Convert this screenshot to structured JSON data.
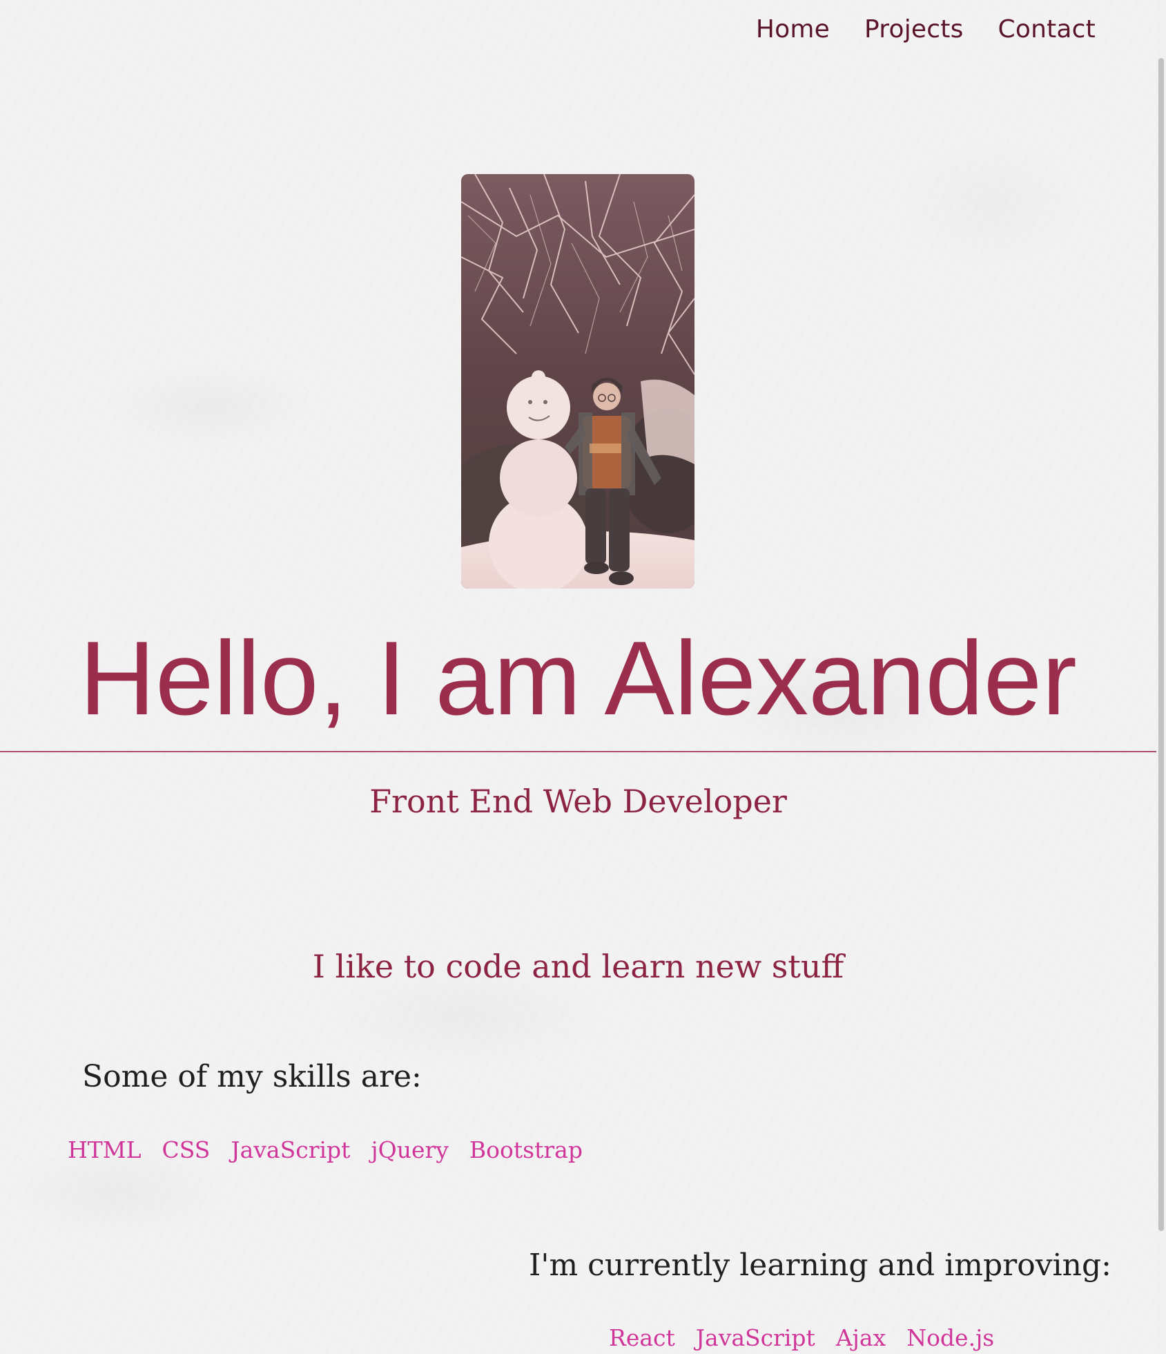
{
  "nav": {
    "items": [
      "Home",
      "Projects",
      "Contact"
    ]
  },
  "hero": {
    "title": "Hello, I am Alexander",
    "subtitle": "Front End Web Developer",
    "tagline": "I like to code and learn new stuff"
  },
  "skills": {
    "heading": "Some of my skills are:",
    "items": [
      "HTML",
      "CSS",
      "JavaScript",
      "jQuery",
      "Bootstrap"
    ]
  },
  "learning": {
    "heading": "I'm currently learning and improving:",
    "items": [
      "React",
      "JavaScript",
      "Ajax",
      "Node.js"
    ]
  },
  "colors": {
    "accent": "#9b2d4d",
    "nav_text": "#5a1428",
    "skill_link": "#d0369a"
  }
}
